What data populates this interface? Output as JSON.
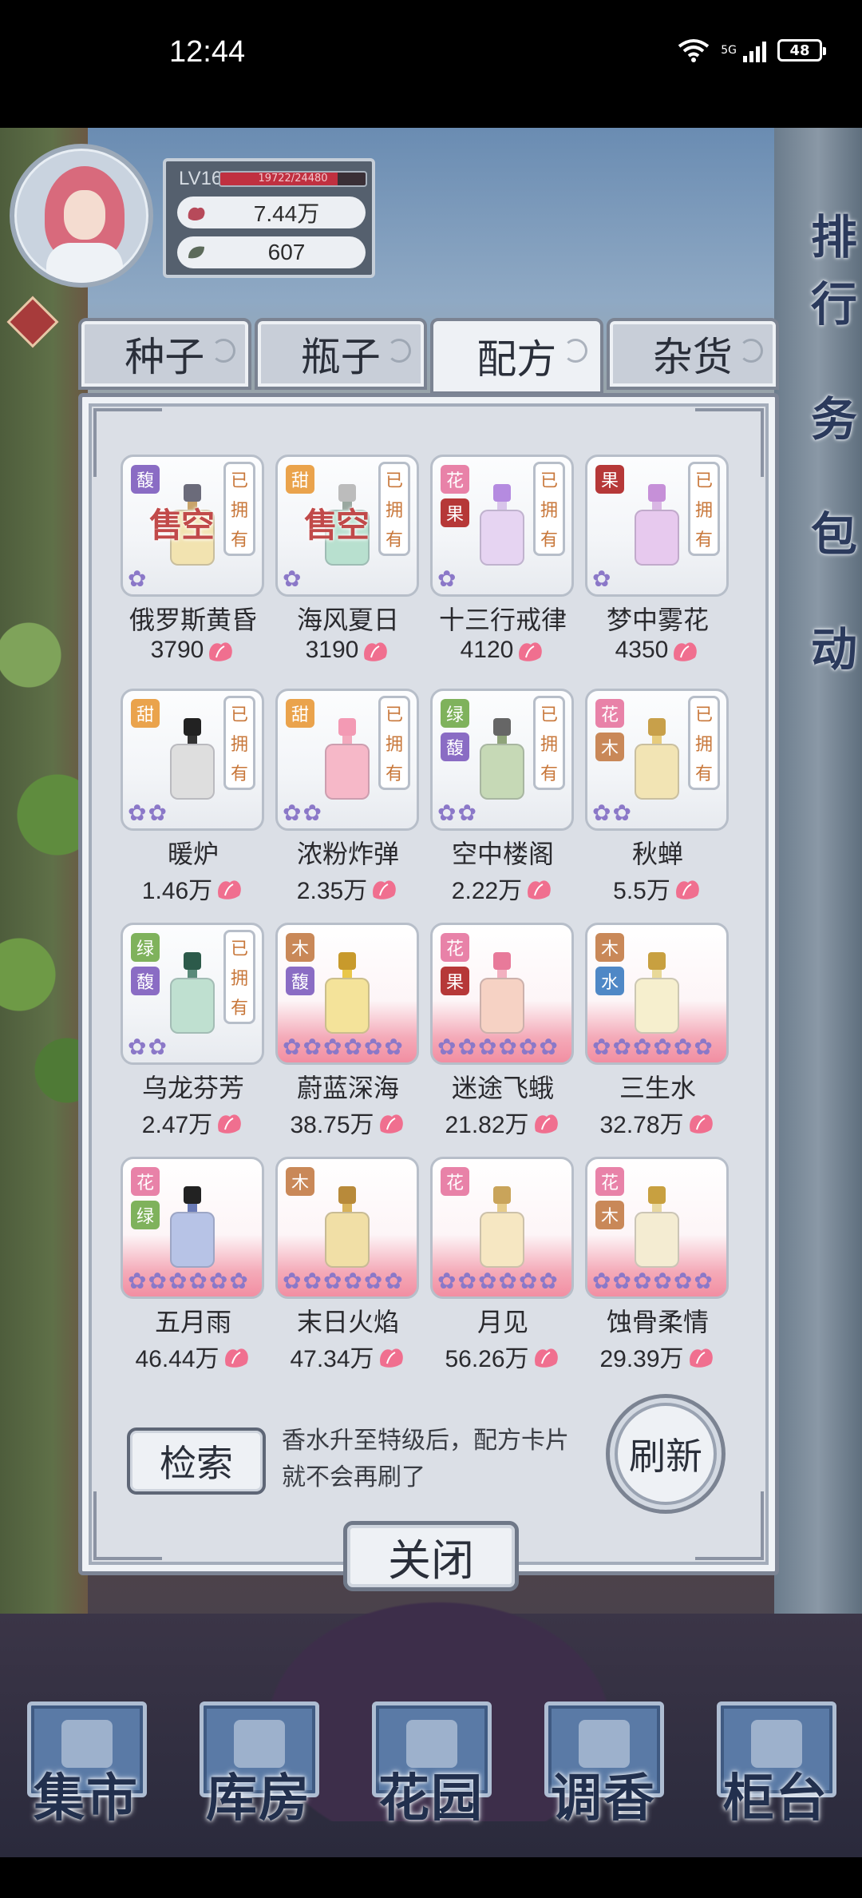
{
  "status_bar": {
    "time": "12:44",
    "network": "5G",
    "battery": "48"
  },
  "player": {
    "level": "LV16",
    "exp": "19722/24480",
    "exp_fraction": 0.806,
    "currency1": "7.44万",
    "currency2": "607"
  },
  "side_menu": [
    "排行",
    "务",
    "包",
    "动"
  ],
  "tabs": [
    {
      "label": "种子",
      "active": false
    },
    {
      "label": "瓶子",
      "active": false
    },
    {
      "label": "配方",
      "active": true
    },
    {
      "label": "杂货",
      "active": false
    }
  ],
  "owned_label": [
    "已",
    "拥",
    "有"
  ],
  "sold_out_label": "售空",
  "items": [
    {
      "name": "俄罗斯黄昏",
      "price": "3790",
      "tags": [
        "馥"
      ],
      "owned": true,
      "sold_out": true
    },
    {
      "name": "海风夏日",
      "price": "3190",
      "tags": [
        "甜"
      ],
      "owned": true,
      "sold_out": true
    },
    {
      "name": "十三行戒律",
      "price": "4120",
      "tags": [
        "花",
        "果"
      ],
      "owned": true,
      "sold_out": false
    },
    {
      "name": "梦中雾花",
      "price": "4350",
      "tags": [
        "果"
      ],
      "owned": true,
      "sold_out": false
    },
    {
      "name": "暖炉",
      "price": "1.46万",
      "tags": [
        "甜"
      ],
      "owned": true,
      "sold_out": false
    },
    {
      "name": "浓粉炸弹",
      "price": "2.35万",
      "tags": [
        "甜"
      ],
      "owned": true,
      "sold_out": false
    },
    {
      "name": "空中楼阁",
      "price": "2.22万",
      "tags": [
        "绿",
        "馥"
      ],
      "owned": true,
      "sold_out": false
    },
    {
      "name": "秋蝉",
      "price": "5.5万",
      "tags": [
        "花",
        "木"
      ],
      "owned": true,
      "sold_out": false
    },
    {
      "name": "乌龙芬芳",
      "price": "2.47万",
      "tags": [
        "绿",
        "馥"
      ],
      "owned": true,
      "sold_out": false
    },
    {
      "name": "蔚蓝深海",
      "price": "38.75万",
      "tags": [
        "木",
        "馥"
      ],
      "owned": false,
      "sold_out": false
    },
    {
      "name": "迷途飞蛾",
      "price": "21.82万",
      "tags": [
        "花",
        "果"
      ],
      "owned": false,
      "sold_out": false
    },
    {
      "name": "三生水",
      "price": "32.78万",
      "tags": [
        "木",
        "水"
      ],
      "owned": false,
      "sold_out": false
    },
    {
      "name": "五月雨",
      "price": "46.44万",
      "tags": [
        "花",
        "绿"
      ],
      "owned": false,
      "sold_out": false
    },
    {
      "name": "末日火焰",
      "price": "47.34万",
      "tags": [
        "木"
      ],
      "owned": false,
      "sold_out": false
    },
    {
      "name": "月见",
      "price": "56.26万",
      "tags": [
        "花"
      ],
      "owned": false,
      "sold_out": false
    },
    {
      "name": "蚀骨柔情",
      "price": "29.39万",
      "tags": [
        "花",
        "木"
      ],
      "owned": false,
      "sold_out": false
    }
  ],
  "search_button": "检索",
  "hint_text": "香水升至特级后，配方卡片就不会再刷了",
  "refresh_button": "刷新",
  "close_button": "关闭",
  "bottom_nav": [
    "集市",
    "库房",
    "花园",
    "调香",
    "柜台"
  ],
  "colors": {
    "panel": "#dbdfe6",
    "frame": "#7d8595",
    "owned_text": "#c8773a",
    "sold_out": "#c14a4a",
    "petal": "#f06f8f"
  }
}
